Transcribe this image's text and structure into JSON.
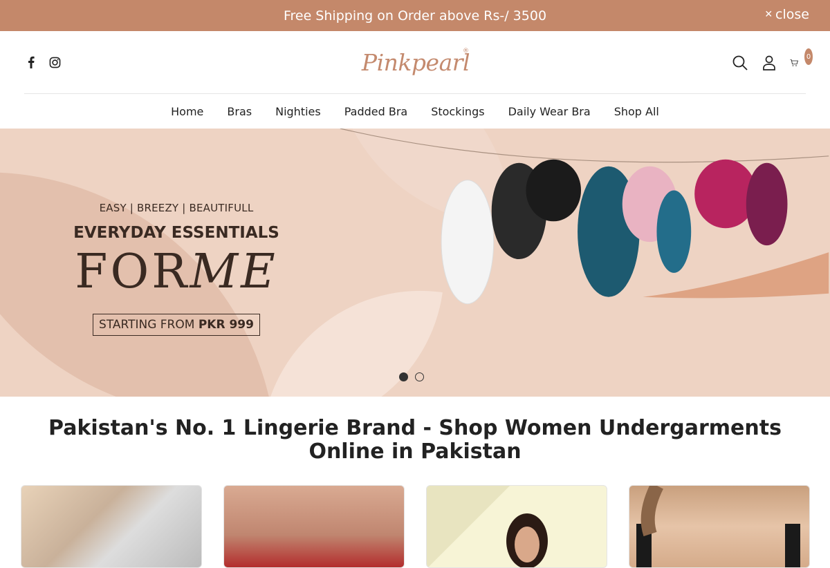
{
  "announcement": {
    "text": "Free Shipping on Order above Rs-/ 3500",
    "close_label": "close",
    "background": "#c4886a"
  },
  "header": {
    "logo_text": "Pinkpearl",
    "logo_reg": "®",
    "social": [
      "facebook-icon",
      "instagram-icon"
    ],
    "icons": [
      "search-icon",
      "account-icon",
      "cart-icon"
    ],
    "cart_count": "0"
  },
  "nav": {
    "items": [
      {
        "label": "Home"
      },
      {
        "label": "Bras"
      },
      {
        "label": "Nighties"
      },
      {
        "label": "Padded Bra"
      },
      {
        "label": "Stockings"
      },
      {
        "label": "Daily Wear Bra"
      },
      {
        "label": "Shop All"
      }
    ]
  },
  "hero": {
    "tagline": "EASY | BREEZY | BEAUTIFULL",
    "headline": "EVERYDAY ESSENTIALS",
    "forme_for": "FOR",
    "forme_me": "ME",
    "starting_prefix": "STARTING FROM ",
    "starting_price": "PKR 999",
    "slides": 2,
    "active_slide": 1
  },
  "section": {
    "title": "Pakistan's No. 1 Lingerie Brand - Shop Women Undergarments Online in Pakistan"
  },
  "colors": {
    "accent": "#c4886a",
    "hero_bg": "#eed3c3",
    "text_dark": "#3a2a22"
  }
}
